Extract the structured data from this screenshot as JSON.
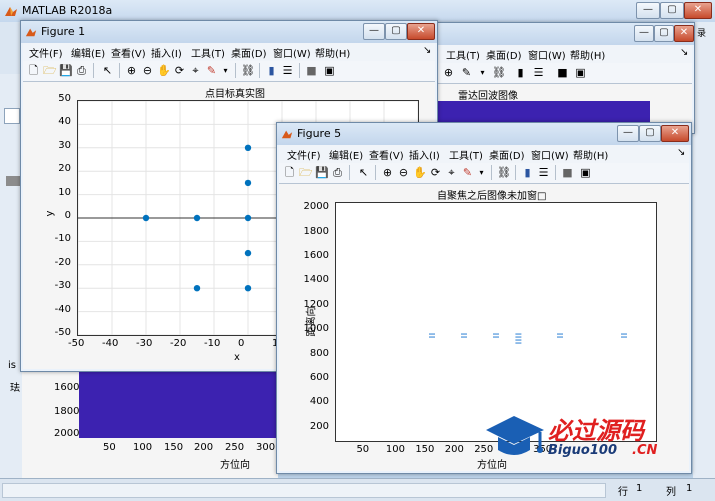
{
  "main": {
    "title": "MATLAB R2018a"
  },
  "figure1": {
    "title": "Figure 1",
    "menu": [
      "文件(F)",
      "编辑(E)",
      "查看(V)",
      "插入(I)",
      "工具(T)",
      "桌面(D)",
      "窗口(W)",
      "帮助(H)"
    ],
    "menu_arrow": "↘"
  },
  "figure5": {
    "title": "Figure 5",
    "menu": [
      "文件(F)",
      "编辑(E)",
      "查看(V)",
      "插入(I)",
      "工具(T)",
      "桌面(D)",
      "窗口(W)",
      "帮助(H)"
    ],
    "menu_arrow": "↘"
  },
  "bg_figure": {
    "menu": [
      "工具(T)",
      "桌面(D)",
      "窗口(W)",
      "帮助(H)"
    ],
    "menu_arrow": "↘",
    "plot_title": "雷达回波图像",
    "bottom_ylabels": [
      "1600",
      "1800",
      "2000"
    ],
    "bottom_xlabels": [
      "50",
      "100",
      "150",
      "200",
      "250",
      "300"
    ],
    "bottom_xlabel": "方位向",
    "accent_color": "#3c22b0"
  },
  "left_strip": {
    "label1": "is",
    "label2": "珐"
  },
  "chart_data": [
    {
      "type": "scatter",
      "title": "点目标真实图",
      "xlabel": "x",
      "ylabel": "y",
      "xlim": [
        -50,
        50
      ],
      "ylim": [
        -50,
        50
      ],
      "xticks": [
        "-50",
        "-40",
        "-30",
        "-20",
        "-10",
        "0",
        "10"
      ],
      "yticks": [
        "50",
        "40",
        "30",
        "20",
        "10",
        "0",
        "-10",
        "-20",
        "-30",
        "-40",
        "-50"
      ],
      "grid": true,
      "color": "#0072bd",
      "points": [
        {
          "x": -30,
          "y": 0
        },
        {
          "x": -15,
          "y": 0
        },
        {
          "x": 0,
          "y": 0
        },
        {
          "x": 0,
          "y": 15
        },
        {
          "x": 0,
          "y": 30
        },
        {
          "x": 0,
          "y": -15
        },
        {
          "x": 0,
          "y": -30
        },
        {
          "x": -15,
          "y": -30
        }
      ]
    },
    {
      "type": "heatmap",
      "title": "自聚焦之后图像未加窗□",
      "xlabel": "方位向",
      "ylabel": "距离向",
      "yticks": [
        "2000",
        "1800",
        "1600",
        "1400",
        "1200",
        "1000",
        "800",
        "600",
        "400",
        "200"
      ],
      "xticks": [
        "50",
        "100",
        "150",
        "200",
        "250",
        "350"
      ],
      "color": "#2a7fd4",
      "marks_y": 960,
      "marks_x": [
        150,
        200,
        250,
        285,
        350,
        450
      ]
    }
  ],
  "status": {
    "row_label": "行",
    "row_value": "1",
    "col_label": "列",
    "col_value": "1"
  },
  "watermark": {
    "main": "必过源码",
    "sub": "Biguo100",
    "cn": ".CN"
  }
}
